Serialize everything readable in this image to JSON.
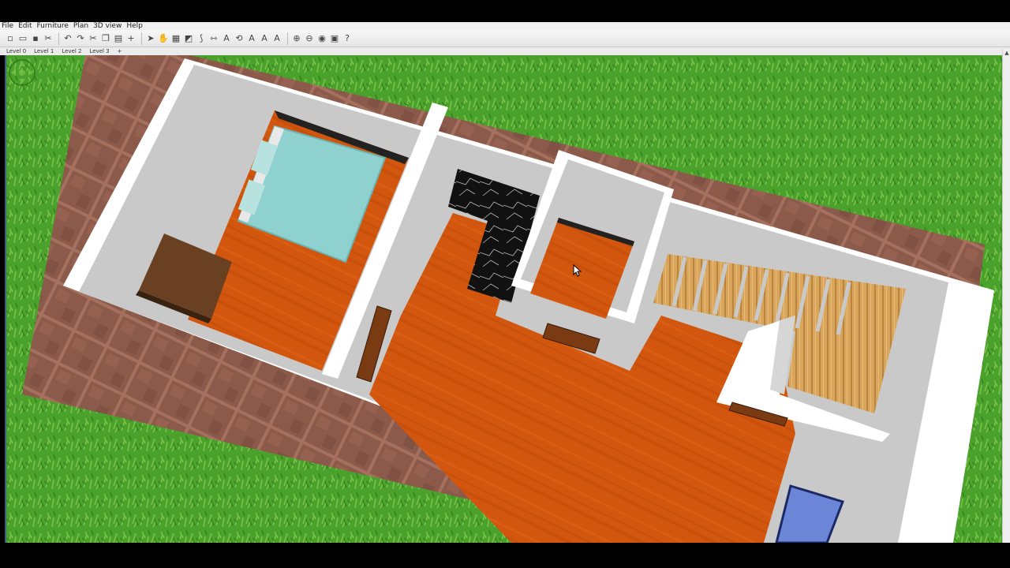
{
  "menu": {
    "items": [
      "File",
      "Edit",
      "Furniture",
      "Plan",
      "3D view",
      "Help"
    ]
  },
  "toolbar": {
    "buttons": [
      {
        "name": "new-icon",
        "glyph": "▫"
      },
      {
        "name": "open-icon",
        "glyph": "▭"
      },
      {
        "name": "save-icon",
        "glyph": "▪"
      },
      {
        "name": "cut-icon",
        "glyph": "✂"
      },
      {
        "name": "undo-icon",
        "glyph": "↶"
      },
      {
        "name": "redo-icon",
        "glyph": "↷"
      },
      {
        "name": "cut2-icon",
        "glyph": "✂"
      },
      {
        "name": "copy-icon",
        "glyph": "❐"
      },
      {
        "name": "paste-icon",
        "glyph": "▤"
      },
      {
        "name": "add-furniture-icon",
        "glyph": "+"
      },
      {
        "name": "select-icon",
        "glyph": "➤"
      },
      {
        "name": "pan-icon",
        "glyph": "✋"
      },
      {
        "name": "create-walls-icon",
        "glyph": "▦"
      },
      {
        "name": "create-rooms-icon",
        "glyph": "◩"
      },
      {
        "name": "create-polylines-icon",
        "glyph": "⟆"
      },
      {
        "name": "create-dimensions-icon",
        "glyph": "⇿"
      },
      {
        "name": "add-text-icon",
        "glyph": "A"
      },
      {
        "name": "modify-icon",
        "glyph": "⟲"
      },
      {
        "name": "text-style-icon",
        "glyph": "A"
      },
      {
        "name": "text-bold-icon",
        "glyph": "A"
      },
      {
        "name": "text-italic-icon",
        "glyph": "A"
      },
      {
        "name": "zoom-in-icon",
        "glyph": "⊕"
      },
      {
        "name": "zoom-out-icon",
        "glyph": "⊖"
      },
      {
        "name": "create-photo-icon",
        "glyph": "◉"
      },
      {
        "name": "create-video-icon",
        "glyph": "▣"
      },
      {
        "name": "help-icon",
        "glyph": "?"
      }
    ]
  },
  "levels": {
    "tabs": [
      "Level 0",
      "Level 1",
      "Level 2",
      "Level 3"
    ],
    "add_label": "+"
  },
  "scene": {
    "description_colors": {
      "grass": "#4aa22c",
      "paving": "#8b5a4a",
      "wall": "#ffffff",
      "wall_side": "#c9c9c9",
      "wood_floor": "#d2560e",
      "bed": "#8fd1cf",
      "marble": "#111111",
      "stairs": "#d9a55b"
    }
  },
  "colors": {
    "accent": "#3b5a86",
    "chrome": "#f0f0f0"
  }
}
